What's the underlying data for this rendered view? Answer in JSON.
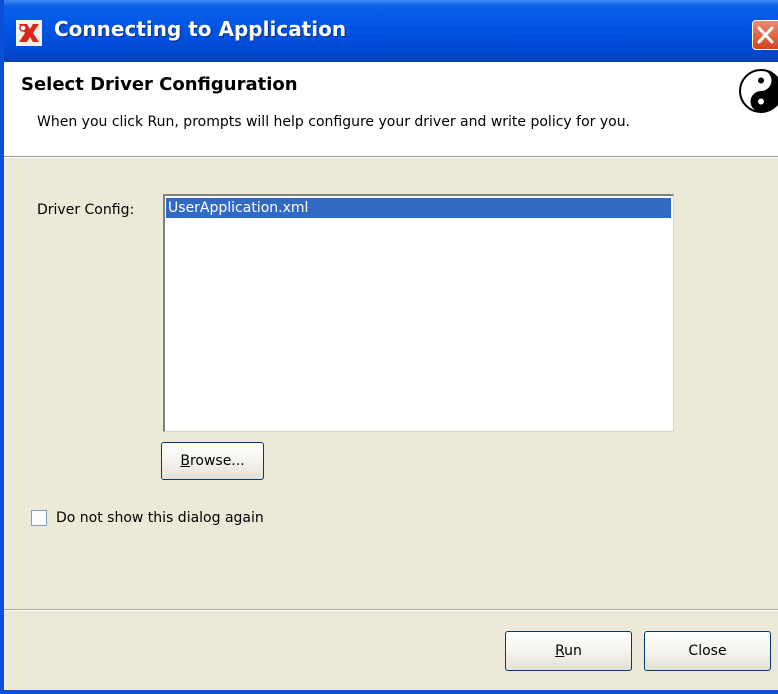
{
  "window": {
    "title": "Connecting to Application",
    "close_icon": "close-icon",
    "app_icon": "novell-designer-icon"
  },
  "header": {
    "title": "Select Driver Configuration",
    "description": "When you click Run, prompts will help configure your driver and write policy for you.",
    "icon": "yin-yang-icon"
  },
  "form": {
    "driver_config_label": "Driver Config:",
    "driver_config_items": [
      "UserApplication.xml"
    ],
    "selected_item": "UserApplication.xml",
    "browse_mnemonic": "B",
    "browse_rest": "rowse...",
    "checkbox_label": "Do not show this dialog again",
    "checkbox_checked": false
  },
  "buttons": {
    "run_mnemonic": "R",
    "run_rest": "un",
    "close_label": "Close"
  },
  "colors": {
    "titlebar": "#0055e5",
    "selection": "#316ac5",
    "dialog_bg": "#ece9d8"
  }
}
